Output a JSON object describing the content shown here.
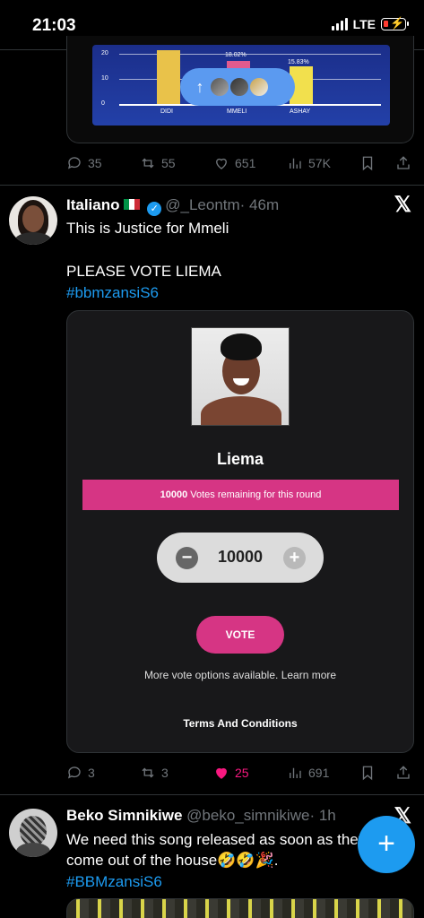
{
  "status_bar": {
    "time": "21:03",
    "network": "LTE"
  },
  "top_tweet": {
    "chart": {
      "ticks": [
        "20",
        "10",
        "0"
      ],
      "percent_labels": [
        "18.02%",
        "15.83%"
      ],
      "categories": [
        "DIDI",
        "MMELI",
        "ASHAY"
      ]
    },
    "actions": {
      "replies": "35",
      "reposts": "55",
      "likes": "651",
      "views": "57K"
    }
  },
  "tweet": {
    "name": "Italiano",
    "handle": "@_Leontm",
    "time": "· 46m",
    "line1": "This is Justice for Mmeli",
    "line2": "PLEASE VOTE LIEMA",
    "hashtag": "#bbmzansiS6",
    "card": {
      "candidate": "Liema",
      "votes_bold": "10000",
      "votes_text": " Votes remaining for this round",
      "stepper_value": "10000",
      "minus": "−",
      "plus": "+",
      "vote_button": "VOTE",
      "more_options": "More vote options available. Learn more",
      "terms": "Terms And Conditions"
    },
    "actions": {
      "replies": "3",
      "reposts": "3",
      "likes": "25",
      "views": "691"
    }
  },
  "tweet2": {
    "name": "Beko Simnikiwe",
    "handle": "@beko_simnikiwe",
    "time": "· 1h",
    "line1": "We need this song released as soon as they",
    "line2": "come out of the house🤣🤣🎉.",
    "hashtag": "#BBMzansiS6"
  },
  "fab_label": "+",
  "x_logo": "𝕏"
}
